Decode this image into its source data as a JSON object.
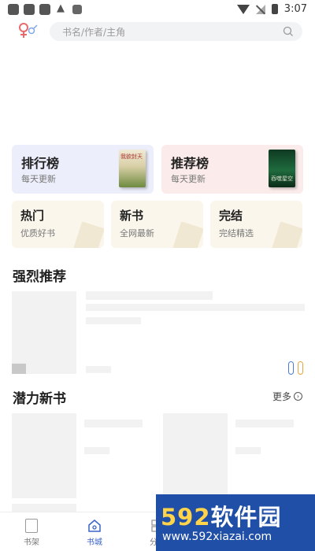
{
  "status_bar": {
    "time": "3:07"
  },
  "search": {
    "placeholder": "书名/作者/主角"
  },
  "top_cards": [
    {
      "title": "排行榜",
      "subtitle": "每天更新",
      "cover_text": "我欲封天"
    },
    {
      "title": "推荐榜",
      "subtitle": "每天更新",
      "cover_text": "吞噬星空"
    }
  ],
  "categories": [
    {
      "title": "热门",
      "subtitle": "优质好书"
    },
    {
      "title": "新书",
      "subtitle": "全网最新"
    },
    {
      "title": "完结",
      "subtitle": "完结精选"
    }
  ],
  "sections": {
    "strong_recommend": "强烈推荐",
    "potential_new": "潜力新书",
    "more": "更多"
  },
  "bottom_nav": [
    {
      "label": "书架"
    },
    {
      "label": "书城"
    },
    {
      "label": "分类"
    }
  ],
  "watermark": {
    "brand_num": "592",
    "brand_text": "软件园",
    "url": "www.592xiazai.com"
  },
  "colors": {
    "accent": "#3a63c8",
    "rank_card_bg": "#eceefb",
    "recommend_card_bg": "#fbeceb",
    "category_bg": "#faf6ec"
  }
}
